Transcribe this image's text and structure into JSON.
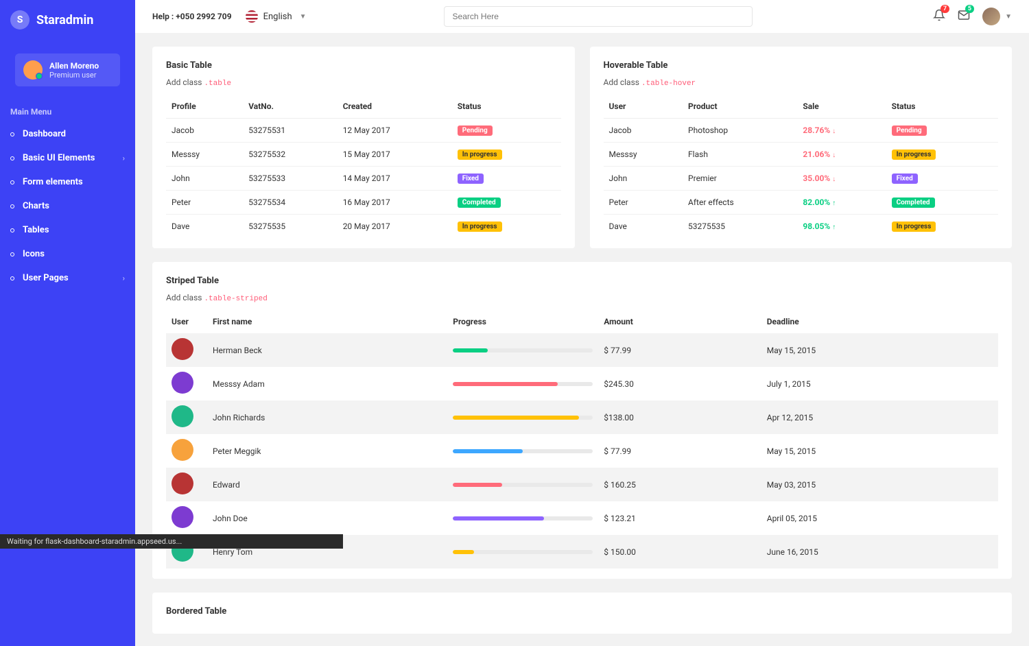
{
  "brand": {
    "initial": "S",
    "name": "Staradmin"
  },
  "user": {
    "name": "Allen Moreno",
    "role": "Premium user"
  },
  "sidebar": {
    "header": "Main Menu",
    "items": [
      {
        "label": "Dashboard",
        "arrow": false
      },
      {
        "label": "Basic UI Elements",
        "arrow": true
      },
      {
        "label": "Form elements",
        "arrow": false
      },
      {
        "label": "Charts",
        "arrow": false
      },
      {
        "label": "Tables",
        "arrow": false
      },
      {
        "label": "Icons",
        "arrow": false
      },
      {
        "label": "User Pages",
        "arrow": true
      }
    ]
  },
  "topbar": {
    "help": "Help : +050 2992 709",
    "language": "English",
    "search_placeholder": "Search Here",
    "notif_count": "7",
    "mail_count": "5"
  },
  "basic_table": {
    "title": "Basic Table",
    "sub_prefix": "Add class ",
    "sub_code": ".table",
    "headers": [
      "Profile",
      "VatNo.",
      "Created",
      "Status"
    ],
    "rows": [
      {
        "profile": "Jacob",
        "vat": "53275531",
        "created": "12 May 2017",
        "status": "Pending",
        "cls": "b-pending"
      },
      {
        "profile": "Messsy",
        "vat": "53275532",
        "created": "15 May 2017",
        "status": "In progress",
        "cls": "b-inprogress"
      },
      {
        "profile": "John",
        "vat": "53275533",
        "created": "14 May 2017",
        "status": "Fixed",
        "cls": "b-fixed"
      },
      {
        "profile": "Peter",
        "vat": "53275534",
        "created": "16 May 2017",
        "status": "Completed",
        "cls": "b-completed"
      },
      {
        "profile": "Dave",
        "vat": "53275535",
        "created": "20 May 2017",
        "status": "In progress",
        "cls": "b-inprogress"
      }
    ]
  },
  "hover_table": {
    "title": "Hoverable Table",
    "sub_prefix": "Add class ",
    "sub_code": ".table-hover",
    "headers": [
      "User",
      "Product",
      "Sale",
      "Status"
    ],
    "rows": [
      {
        "user": "Jacob",
        "product": "Photoshop",
        "sale": "28.76%",
        "dir": "down",
        "status": "Pending",
        "cls": "b-pending"
      },
      {
        "user": "Messsy",
        "product": "Flash",
        "sale": "21.06%",
        "dir": "down",
        "status": "In progress",
        "cls": "b-inprogress"
      },
      {
        "user": "John",
        "product": "Premier",
        "sale": "35.00%",
        "dir": "down",
        "status": "Fixed",
        "cls": "b-fixed"
      },
      {
        "user": "Peter",
        "product": "After effects",
        "sale": "82.00%",
        "dir": "up",
        "status": "Completed",
        "cls": "b-completed"
      },
      {
        "user": "Dave",
        "product": "53275535",
        "sale": "98.05%",
        "dir": "up",
        "status": "In progress",
        "cls": "b-inprogress"
      }
    ]
  },
  "striped_table": {
    "title": "Striped Table",
    "sub_prefix": "Add class ",
    "sub_code": ".table-striped",
    "headers": [
      "User",
      "First name",
      "Progress",
      "Amount",
      "Deadline"
    ],
    "rows": [
      {
        "color": "#b83434",
        "name": "Herman Beck",
        "pct": 25,
        "pcolor": "#0acf83",
        "amount": "$ 77.99",
        "deadline": "May 15, 2015"
      },
      {
        "color": "#7d3bd1",
        "name": "Messsy Adam",
        "pct": 75,
        "pcolor": "#ff6b7a",
        "amount": "$245.30",
        "deadline": "July 1, 2015"
      },
      {
        "color": "#1fb888",
        "name": "John Richards",
        "pct": 90,
        "pcolor": "#ffc107",
        "amount": "$138.00",
        "deadline": "Apr 12, 2015"
      },
      {
        "color": "#f7a23c",
        "name": "Peter Meggik",
        "pct": 50,
        "pcolor": "#3da7ff",
        "amount": "$ 77.99",
        "deadline": "May 15, 2015"
      },
      {
        "color": "#b83434",
        "name": "Edward",
        "pct": 35,
        "pcolor": "#ff6b7a",
        "amount": "$ 160.25",
        "deadline": "May 03, 2015"
      },
      {
        "color": "#7d3bd1",
        "name": "John Doe",
        "pct": 65,
        "pcolor": "#8e63ff",
        "amount": "$ 123.21",
        "deadline": "April 05, 2015"
      },
      {
        "color": "#1fb888",
        "name": "Henry Tom",
        "pct": 15,
        "pcolor": "#ffc107",
        "amount": "$ 150.00",
        "deadline": "June 16, 2015"
      }
    ]
  },
  "bordered_table": {
    "title": "Bordered Table"
  },
  "status_line": "Waiting for flask-dashboard-staradmin.appseed.us..."
}
